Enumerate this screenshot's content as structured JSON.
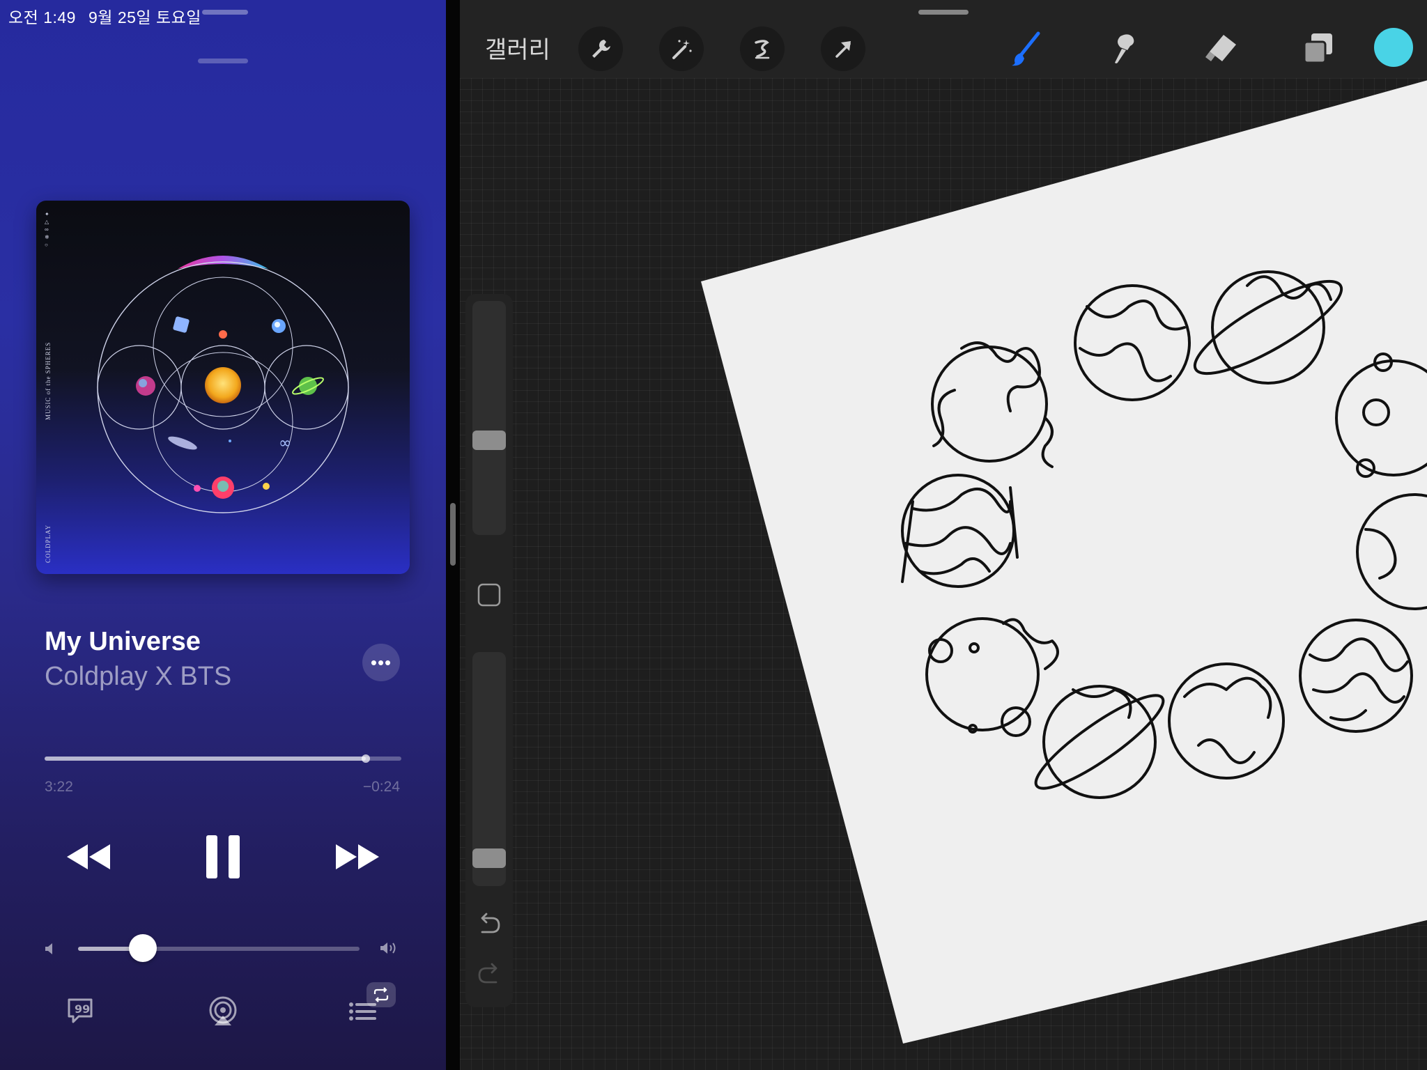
{
  "status_bar": {
    "time": "오전 1:49",
    "date": "9월 25일 토요일"
  },
  "music": {
    "song_title": "My Universe",
    "artist": "Coldplay X BTS",
    "progress": 0.9,
    "elapsed": "3:22",
    "remaining": "−0:24",
    "volume": 0.23,
    "album_cover": {
      "side_text_top": "MUSIC of the SPHERES",
      "side_text_bottom": "COLDPLAY"
    },
    "icons": {
      "more": "ellipsis-icon",
      "rewind": "rewind-icon",
      "pause": "pause-icon",
      "forward": "fast-forward-icon",
      "volume_low": "speaker-low-icon",
      "volume_high": "speaker-high-icon",
      "lyrics": "lyrics-icon",
      "airplay": "airplay-icon",
      "queue": "queue-icon",
      "repeat": "repeat-icon"
    }
  },
  "procreate": {
    "gallery_label": "갤러리",
    "active_color": "#49d3e6",
    "brush_accent": "#1c6fff",
    "tools": [
      "wrench-icon",
      "magic-wand-icon",
      "selection-icon",
      "transform-arrow-icon",
      "brush-icon",
      "smudge-icon",
      "eraser-icon",
      "layers-icon"
    ],
    "sidebar": [
      "brush-size-slider",
      "modify-button",
      "opacity-slider",
      "undo-icon",
      "redo-icon"
    ]
  }
}
